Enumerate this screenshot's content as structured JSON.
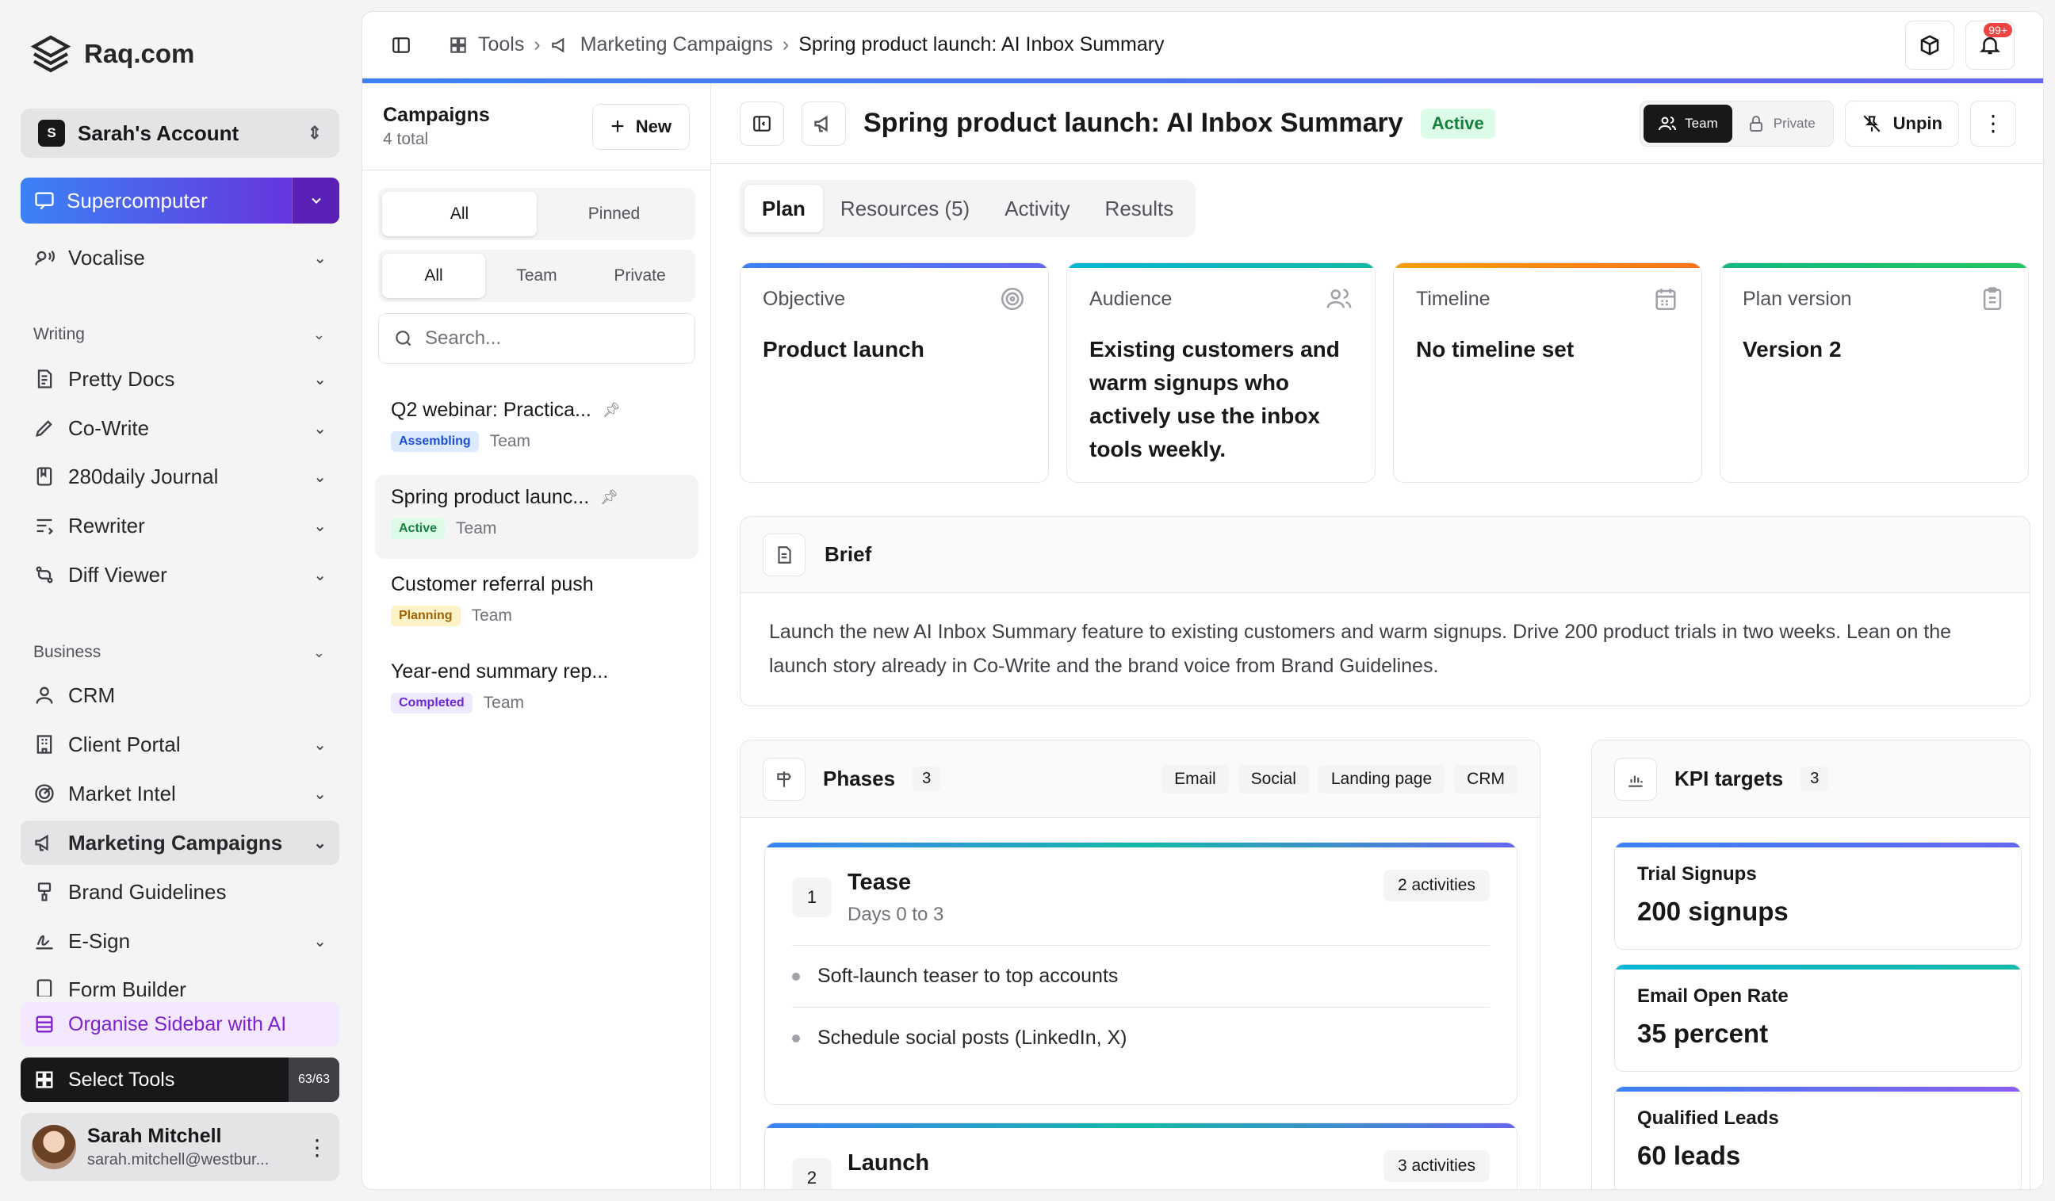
{
  "brand": {
    "name": "Raq.com"
  },
  "account": {
    "name": "Sarah's Account",
    "initial": "S"
  },
  "supercomputer": {
    "label": "Supercomputer"
  },
  "sidebar": {
    "vocalise": "Vocalise",
    "writing_header": "Writing",
    "writing": [
      "Pretty Docs",
      "Co-Write",
      "280daily Journal",
      "Rewriter",
      "Diff Viewer"
    ],
    "business_header": "Business",
    "business": [
      "CRM",
      "Client Portal",
      "Market Intel",
      "Marketing Campaigns",
      "Brand Guidelines",
      "E-Sign",
      "Form Builder"
    ],
    "organise": "Organise Sidebar with AI",
    "select_tools": "Select Tools",
    "select_count": "63/63"
  },
  "user": {
    "name": "Sarah Mitchell",
    "email": "sarah.mitchell@westbur..."
  },
  "breadcrumb": {
    "tools": "Tools",
    "campaigns": "Marketing Campaigns",
    "current": "Spring product launch: AI Inbox Summary"
  },
  "notifications": {
    "badge": "99+"
  },
  "campaigns": {
    "title": "Campaigns",
    "count": "4 total",
    "new_label": "New",
    "filter1": [
      "All",
      "Pinned"
    ],
    "filter2": [
      "All",
      "Team",
      "Private"
    ],
    "search_placeholder": "Search...",
    "items": [
      {
        "name": "Q2 webinar: Practica...",
        "status": "Assembling",
        "scope": "Team"
      },
      {
        "name": "Spring product launc...",
        "status": "Active",
        "scope": "Team"
      },
      {
        "name": "Customer referral push",
        "status": "Planning",
        "scope": "Team"
      },
      {
        "name": "Year-end summary rep...",
        "status": "Completed",
        "scope": "Team"
      }
    ]
  },
  "detail": {
    "title": "Spring product launch: AI Inbox Summary",
    "status": "Active",
    "visibility": [
      "Team",
      "Private"
    ],
    "unpin": "Unpin",
    "tabs": [
      "Plan",
      "Resources (5)",
      "Activity",
      "Results"
    ],
    "summary": [
      {
        "label": "Objective",
        "value": "Product launch",
        "color": "#3b82f6"
      },
      {
        "label": "Audience",
        "value": "Existing customers and warm signups who actively use the inbox tools weekly.",
        "color": "#06b6d4"
      },
      {
        "label": "Timeline",
        "value": "No timeline set",
        "color": "#f97316"
      },
      {
        "label": "Plan version",
        "value": "Version 2",
        "color": "#22c55e"
      }
    ],
    "brief_title": "Brief",
    "brief_text": "Launch the new AI Inbox Summary feature to existing customers and warm signups. Drive 200 product trials in two weeks. Lean on the launch story already in Co-Write and the brand voice from Brand Guidelines.",
    "phases_title": "Phases",
    "phases_count": "3",
    "channels": [
      "Email",
      "Social",
      "Landing page",
      "CRM"
    ],
    "phases": [
      {
        "num": "1",
        "name": "Tease",
        "days": "Days 0 to 3",
        "acts": "2 activities",
        "items": [
          "Soft-launch teaser to top accounts",
          "Schedule social posts (LinkedIn, X)"
        ]
      },
      {
        "num": "2",
        "name": "Launch",
        "days": "",
        "acts": "3 activities",
        "items": []
      }
    ],
    "kpi_title": "KPI targets",
    "kpi_count": "3",
    "kpis": [
      {
        "label": "Trial Signups",
        "value": "200 signups"
      },
      {
        "label": "Email Open Rate",
        "value": "35 percent"
      },
      {
        "label": "Qualified Leads",
        "value": "60 leads"
      }
    ]
  }
}
